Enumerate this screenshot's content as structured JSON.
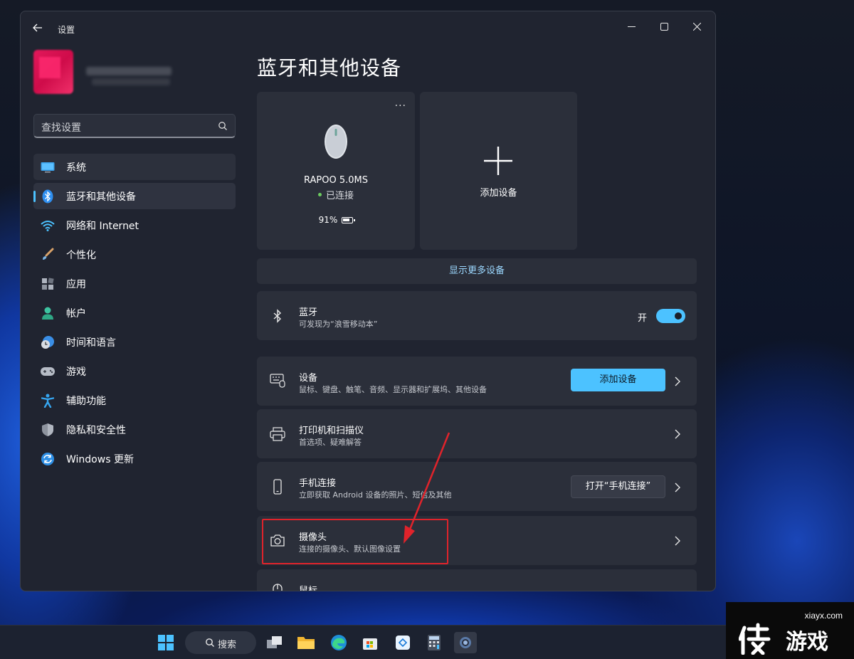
{
  "window": {
    "title": "设置"
  },
  "sidebar": {
    "search_placeholder": "查找设置",
    "items": [
      {
        "label": "系统",
        "icon": "monitor-icon"
      },
      {
        "label": "蓝牙和其他设备",
        "icon": "bluetooth-icon",
        "active": true
      },
      {
        "label": "网络和 Internet",
        "icon": "wifi-icon"
      },
      {
        "label": "个性化",
        "icon": "brush-icon"
      },
      {
        "label": "应用",
        "icon": "apps-icon"
      },
      {
        "label": "帐户",
        "icon": "person-icon"
      },
      {
        "label": "时间和语言",
        "icon": "clock-globe-icon"
      },
      {
        "label": "游戏",
        "icon": "gamepad-icon"
      },
      {
        "label": "辅助功能",
        "icon": "accessibility-icon"
      },
      {
        "label": "隐私和安全性",
        "icon": "shield-icon"
      },
      {
        "label": "Windows 更新",
        "icon": "update-icon"
      }
    ]
  },
  "main": {
    "title": "蓝牙和其他设备",
    "device_card": {
      "name": "RAPOO 5.0MS",
      "status": "已连接",
      "battery": "91%",
      "menu": "···"
    },
    "add_card": {
      "label": "添加设备"
    },
    "show_more": "显示更多设备",
    "bluetooth_row": {
      "title": "蓝牙",
      "subtitle": "可发现为“浪雪移动本”",
      "toggle_label": "开",
      "toggle_on": true
    },
    "devices_row": {
      "title": "设备",
      "subtitle": "鼠标、键盘、触笔、音频、显示器和扩展坞、其他设备",
      "button": "添加设备"
    },
    "printers_row": {
      "title": "打印机和扫描仪",
      "subtitle": "首选项、疑难解答"
    },
    "phone_row": {
      "title": "手机连接",
      "subtitle": "立即获取 Android 设备的照片、短信及其他",
      "button": "打开“手机连接”"
    },
    "camera_row": {
      "title": "摄像头",
      "subtitle": "连接的摄像头、默认图像设置"
    },
    "mouse_row": {
      "title": "鼠标"
    }
  },
  "taskbar": {
    "search_label": "搜索"
  },
  "watermark": {
    "url": "xiayx.com",
    "logo_text": "侠游戏"
  },
  "colors": {
    "accent": "#4cc2ff",
    "highlight": "#e0232b",
    "window_bg": "#202430",
    "card_bg": "#2b2f3a"
  }
}
